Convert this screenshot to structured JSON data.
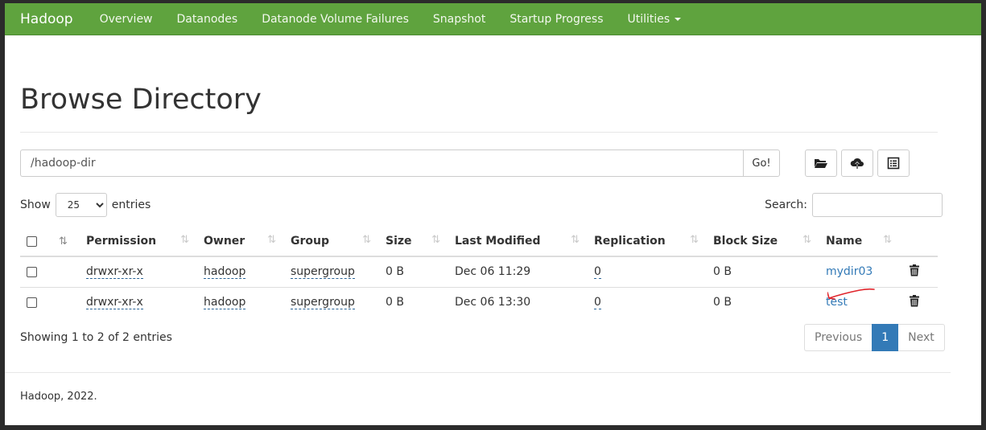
{
  "navbar": {
    "brand": "Hadoop",
    "items": [
      "Overview",
      "Datanodes",
      "Datanode Volume Failures",
      "Snapshot",
      "Startup Progress",
      "Utilities"
    ]
  },
  "page": {
    "title": "Browse Directory"
  },
  "path_bar": {
    "value": "/hadoop-dir",
    "go_label": "Go!"
  },
  "toolbar_icons": [
    "folder-open-icon",
    "cloud-upload-icon",
    "list-alt-icon"
  ],
  "length_menu": {
    "show_label": "Show",
    "selected": "25",
    "entries_label": "entries"
  },
  "search": {
    "label": "Search:",
    "value": ""
  },
  "table": {
    "columns": [
      "Permission",
      "Owner",
      "Group",
      "Size",
      "Last Modified",
      "Replication",
      "Block Size",
      "Name"
    ],
    "rows": [
      {
        "permission": "drwxr-xr-x",
        "owner": "hadoop",
        "group": "supergroup",
        "size": "0 B",
        "modified": "Dec 06 11:29",
        "replication": "0",
        "block_size": "0 B",
        "name": "mydir03"
      },
      {
        "permission": "drwxr-xr-x",
        "owner": "hadoop",
        "group": "supergroup",
        "size": "0 B",
        "modified": "Dec 06 13:30",
        "replication": "0",
        "block_size": "0 B",
        "name": "test"
      }
    ]
  },
  "info": "Showing 1 to 2 of 2 entries",
  "pagination": {
    "previous": "Previous",
    "current": "1",
    "next": "Next"
  },
  "footer": "Hadoop, 2022.",
  "colors": {
    "navbar": "#5fa33e",
    "link": "#337ab7",
    "active_page": "#337ab7",
    "annotation": "#e0242b"
  }
}
